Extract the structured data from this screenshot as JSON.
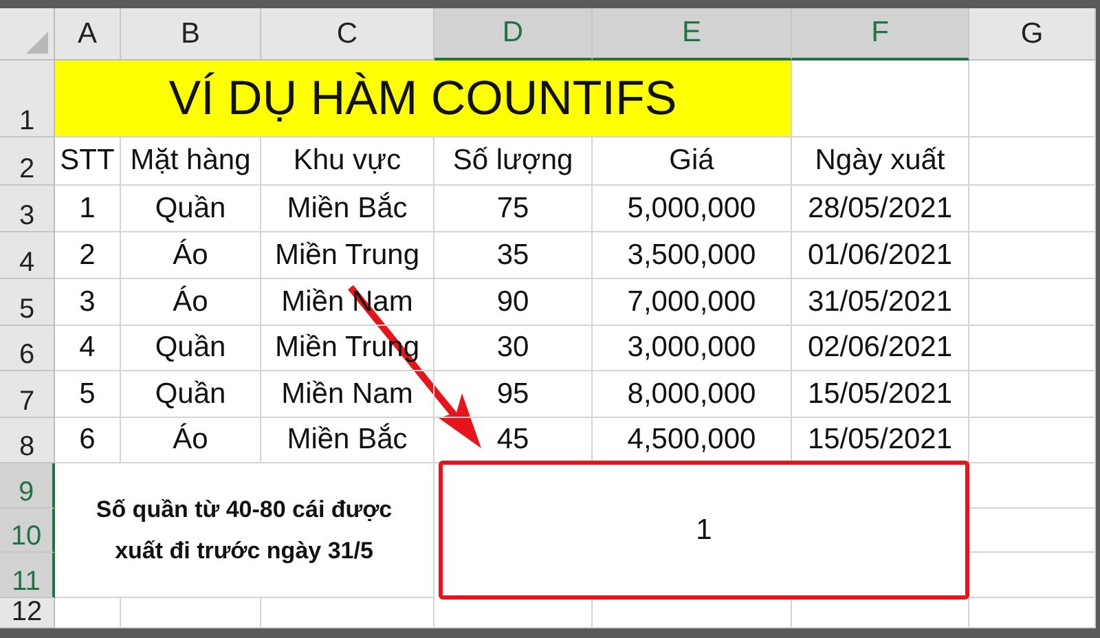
{
  "column_headers": [
    {
      "label": "A",
      "selected": false
    },
    {
      "label": "B",
      "selected": false
    },
    {
      "label": "C",
      "selected": false
    },
    {
      "label": "D",
      "selected": true
    },
    {
      "label": "E",
      "selected": true
    },
    {
      "label": "F",
      "selected": true
    },
    {
      "label": "G",
      "selected": false
    }
  ],
  "row_headers": [
    {
      "label": "1",
      "selected": false
    },
    {
      "label": "2",
      "selected": false
    },
    {
      "label": "3",
      "selected": false
    },
    {
      "label": "4",
      "selected": false
    },
    {
      "label": "5",
      "selected": false
    },
    {
      "label": "6",
      "selected": false
    },
    {
      "label": "7",
      "selected": false
    },
    {
      "label": "8",
      "selected": false
    },
    {
      "label": "9",
      "selected": true
    },
    {
      "label": "10",
      "selected": true
    },
    {
      "label": "11",
      "selected": true
    },
    {
      "label": "12",
      "selected": false
    }
  ],
  "title": "VÍ DỤ HÀM COUNTIFS",
  "table": {
    "columns": [
      "STT",
      "Mặt hàng",
      "Khu vực",
      "Số lượng",
      "Giá",
      "Ngày xuất"
    ],
    "rows": [
      [
        "1",
        "Quần",
        "Miền Bắc",
        "75",
        "5,000,000",
        "28/05/2021"
      ],
      [
        "2",
        "Áo",
        "Miền Trung",
        "35",
        "3,500,000",
        "01/06/2021"
      ],
      [
        "3",
        "Áo",
        "Miền Nam",
        "90",
        "7,000,000",
        "31/05/2021"
      ],
      [
        "4",
        "Quần",
        "Miền Trung",
        "30",
        "3,000,000",
        "02/06/2021"
      ],
      [
        "5",
        "Quần",
        "Miền Nam",
        "95",
        "8,000,000",
        "15/05/2021"
      ],
      [
        "6",
        "Áo",
        "Miền Bắc",
        "45",
        "4,500,000",
        "15/05/2021"
      ]
    ]
  },
  "criteria_note": "Số quần từ 40-80 cái được xuất đi trước ngày 31/5",
  "result": {
    "value": "1",
    "highlighted": true
  },
  "annotations": [
    {
      "kind": "arrow"
    }
  ]
}
